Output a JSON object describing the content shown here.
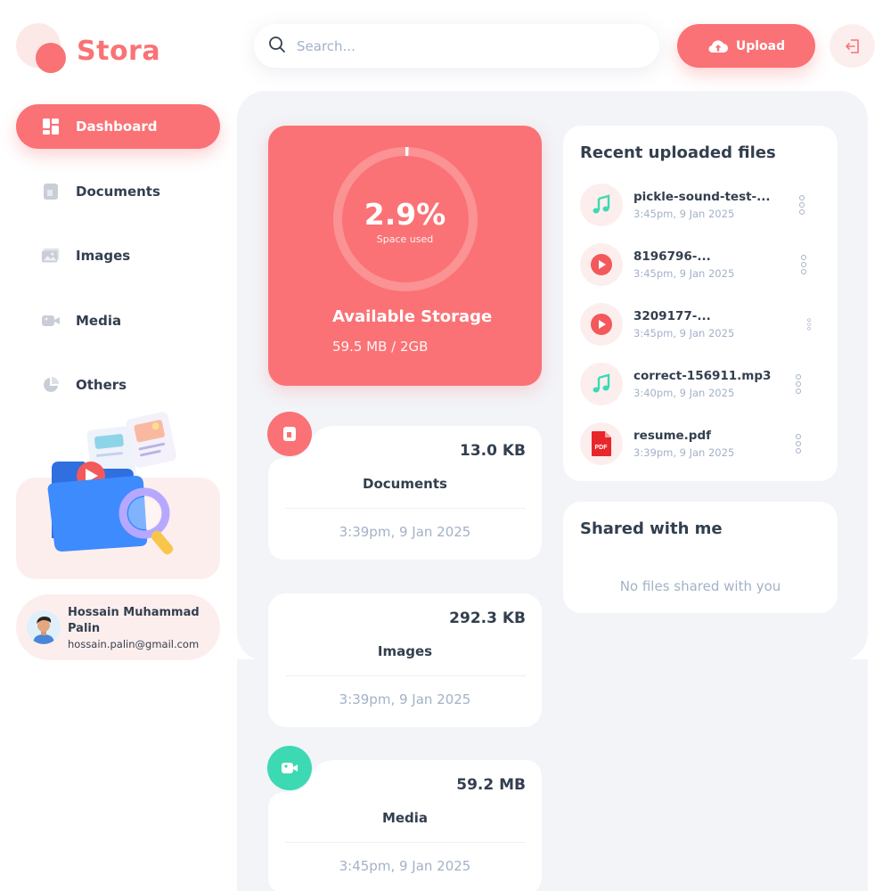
{
  "brand": {
    "name": "Stora"
  },
  "colors": {
    "brand": "#fa7275",
    "brand_light": "#fdeeee",
    "media": "#3dd9b3",
    "text": "#333f4e",
    "muted": "#a3b2c7",
    "panel": "#f2f4f8"
  },
  "sidebar": {
    "items": [
      {
        "label": "Dashboard",
        "icon": "dashboard-icon",
        "active": true
      },
      {
        "label": "Documents",
        "icon": "documents-icon"
      },
      {
        "label": "Images",
        "icon": "images-icon"
      },
      {
        "label": "Media",
        "icon": "video-icon"
      },
      {
        "label": "Others",
        "icon": "pie-chart-icon"
      }
    ]
  },
  "user": {
    "name": "Hossain Muhammad Palin",
    "email": "hossain.palin@gmail.com"
  },
  "header": {
    "search_placeholder": "Search...",
    "upload_label": "Upload"
  },
  "storage": {
    "percent_label": "2.9%",
    "percent_value": 2.9,
    "sub_label": "Space used",
    "title": "Available Storage",
    "usage": "59.5 MB / 2GB"
  },
  "categories": [
    {
      "name": "Documents",
      "size": "13.0 KB",
      "date": "3:39pm, 9 Jan 2025",
      "icon": "document-icon"
    },
    {
      "name": "Images",
      "size": "292.3 KB",
      "date": "3:39pm, 9 Jan 2025",
      "icon": "image-icon"
    },
    {
      "name": "Media",
      "size": "59.2 MB",
      "date": "3:45pm, 9 Jan 2025",
      "icon": "video-icon"
    }
  ],
  "recent": {
    "title": "Recent uploaded files",
    "files": [
      {
        "name": "pickle-sound-test-...",
        "date": "3:45pm, 9 Jan 2025",
        "type": "audio"
      },
      {
        "name": "8196796-...",
        "date": "3:45pm, 9 Jan 2025",
        "type": "video"
      },
      {
        "name": "3209177-...",
        "date": "3:45pm, 9 Jan 2025",
        "type": "video"
      },
      {
        "name": "correct-156911.mp3",
        "date": "3:40pm, 9 Jan 2025",
        "type": "audio"
      },
      {
        "name": "resume.pdf",
        "date": "3:39pm, 9 Jan 2025",
        "type": "pdf",
        "badge": "PDF"
      }
    ]
  },
  "shared": {
    "title": "Shared with me",
    "empty": "No files shared with you"
  }
}
